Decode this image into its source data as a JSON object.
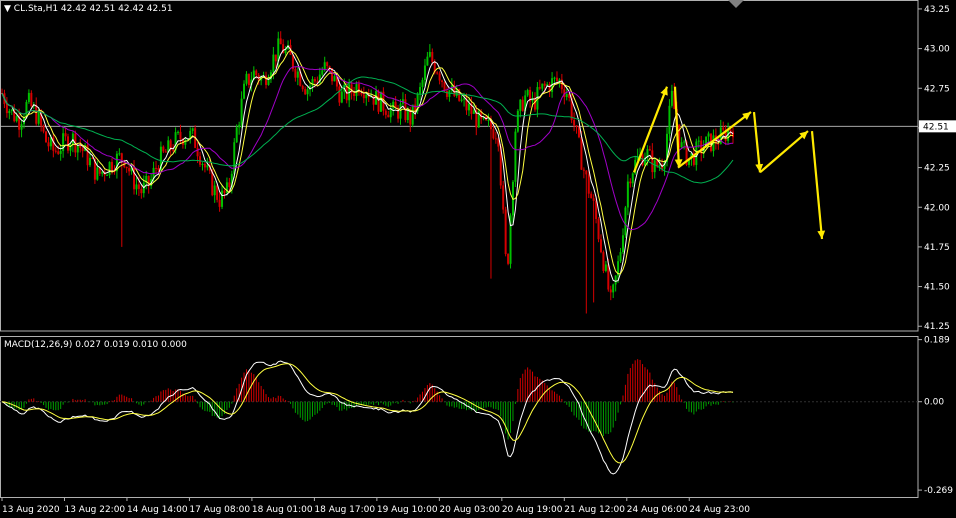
{
  "header": {
    "price_title": "CL.Sta,H1  42.42 42.51 42.42 42.51",
    "macd_title": "MACD(12,26,9) 0.027 0.019 0.010 0.000"
  },
  "chart_data": [
    {
      "type": "candlestick",
      "title": "CL.Sta,H1",
      "ohlc_last": [
        42.42,
        42.51,
        42.42,
        42.51
      ],
      "ylim": [
        41.22,
        43.3
      ],
      "y_ticks": [
        "43.25",
        "43.00",
        "42.75",
        "42.50",
        "42.25",
        "42.00",
        "41.75",
        "41.50",
        "41.25"
      ],
      "current_price_label": "42.51",
      "current_price": 42.51,
      "x_ticks": [
        "13 Aug 2020",
        "13 Aug 22:00",
        "14 Aug 14:00",
        "17 Aug 08:00",
        "18 Aug 01:00",
        "18 Aug 17:00",
        "19 Aug 10:00",
        "20 Aug 03:00",
        "20 Aug 19:00",
        "21 Aug 12:00",
        "24 Aug 06:00",
        "24 Aug 23:00"
      ],
      "price_path": [
        42.72,
        42.6,
        42.55,
        42.66,
        42.58,
        42.42,
        42.35,
        42.4,
        42.44,
        42.38,
        42.3,
        42.2,
        42.25,
        42.3,
        42.32,
        42.18,
        42.1,
        42.15,
        42.3,
        42.35,
        42.42,
        42.46,
        42.44,
        42.3,
        42.15,
        42.05,
        42.1,
        42.5,
        42.78,
        42.85,
        42.8,
        42.92,
        43.02,
        42.95,
        42.85,
        42.75,
        42.8,
        42.88,
        42.82,
        42.7,
        42.72,
        42.78,
        42.74,
        42.68,
        42.64,
        42.6,
        42.62,
        42.55,
        42.72,
        42.95,
        42.88,
        42.76,
        42.7,
        42.65,
        42.6,
        42.52,
        42.5,
        42.48,
        41.55,
        42.5,
        42.7,
        42.65,
        42.74,
        42.78,
        42.8,
        42.72,
        42.45,
        42.2,
        42.0,
        41.7,
        41.38,
        41.7,
        42.2,
        42.3,
        42.35,
        42.25,
        42.3,
        42.7,
        42.38,
        42.3,
        42.36,
        42.4,
        42.42,
        42.46,
        42.51
      ],
      "arrows": [
        [
          [
            42.22,
            42.76
          ],
          [
            42.76,
            42.25
          ],
          [
            42.25,
            42.6
          ]
        ],
        [
          [
            42.6,
            42.22
          ],
          [
            42.22,
            42.48
          ],
          [
            42.48,
            41.8
          ]
        ]
      ],
      "colors": {
        "bull": "#00c000",
        "bear": "#d60000",
        "ma_white": "#ffffff",
        "ma_yellow": "#ffff40",
        "ma_violet": "#a000c8",
        "ma_green": "#00b050",
        "arrow": "#ffea00",
        "price_line": "#c0c0c0"
      }
    },
    {
      "type": "macd",
      "title": "MACD(12,26,9)",
      "params": [
        12,
        26,
        9
      ],
      "readout": [
        0.027,
        0.019,
        0.01,
        0.0
      ],
      "ylim": [
        -0.29,
        0.2
      ],
      "y_ticks": [
        "0.189",
        "0.00",
        "-0.269"
      ],
      "x_ticks": [
        "13 Aug 2020",
        "13 Aug 22:00",
        "14 Aug 14:00",
        "17 Aug 08:00",
        "18 Aug 01:00",
        "18 Aug 17:00",
        "19 Aug 10:00",
        "20 Aug 03:00",
        "20 Aug 19:00",
        "21 Aug 12:00",
        "24 Aug 06:00",
        "24 Aug 23:00"
      ],
      "colors": {
        "macd": "#ffffff",
        "signal": "#ffff40",
        "hist_pos": "#d60000",
        "hist_neg": "#00a000"
      }
    }
  ]
}
